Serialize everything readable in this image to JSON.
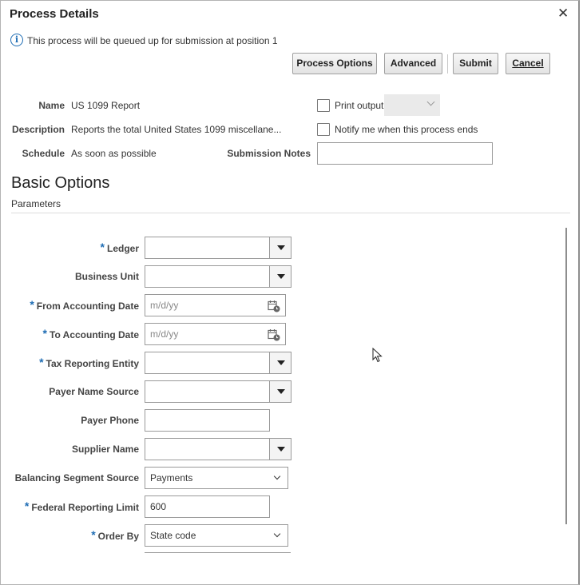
{
  "dialog": {
    "title": "Process Details",
    "close_glyph": "✕"
  },
  "info": {
    "icon": "info-icon",
    "icon_glyph": "i",
    "message": "This process will be queued up for submission at position 1"
  },
  "toolbar": {
    "process_options": "Process Options",
    "advanced": "Advanced",
    "submit": "Submit",
    "cancel": "Cancel"
  },
  "details": {
    "name_label": "Name",
    "name_value": "US 1099 Report",
    "description_label": "Description",
    "description_value": "Reports the total United States 1099 miscellane...",
    "schedule_label": "Schedule",
    "schedule_value": "As soon as possible",
    "print_output_label": "Print output",
    "print_output_checked": false,
    "notify_label": "Notify me when this process ends",
    "notify_checked": false,
    "submission_notes_label": "Submission Notes",
    "submission_notes_value": ""
  },
  "basic_options": {
    "title": "Basic Options",
    "subtitle": "Parameters"
  },
  "parameters": {
    "required_marker": "*",
    "ledger": {
      "label": "Ledger",
      "value": "",
      "required": true
    },
    "business_unit": {
      "label": "Business Unit",
      "value": "",
      "required": false
    },
    "from_accounting_date": {
      "label": "From Accounting Date",
      "placeholder": "m/d/yy",
      "required": true
    },
    "to_accounting_date": {
      "label": "To Accounting Date",
      "placeholder": "m/d/yy",
      "required": true
    },
    "tax_reporting_entity": {
      "label": "Tax Reporting Entity",
      "value": "",
      "required": true
    },
    "payer_name_source": {
      "label": "Payer Name Source",
      "value": "",
      "required": false
    },
    "payer_phone": {
      "label": "Payer Phone",
      "value": "",
      "required": false
    },
    "supplier_name": {
      "label": "Supplier Name",
      "value": "",
      "required": false
    },
    "balancing_segment_source": {
      "label": "Balancing Segment Source",
      "value": "Payments",
      "required": false
    },
    "federal_reporting_limit": {
      "label": "Federal Reporting Limit",
      "value": "600",
      "required": true
    },
    "order_by": {
      "label": "Order By",
      "value": "State code",
      "required": true
    }
  },
  "colors": {
    "accent": "#1f6db4",
    "border": "#9a9a9a",
    "button_bg": "#e3e3e3"
  }
}
